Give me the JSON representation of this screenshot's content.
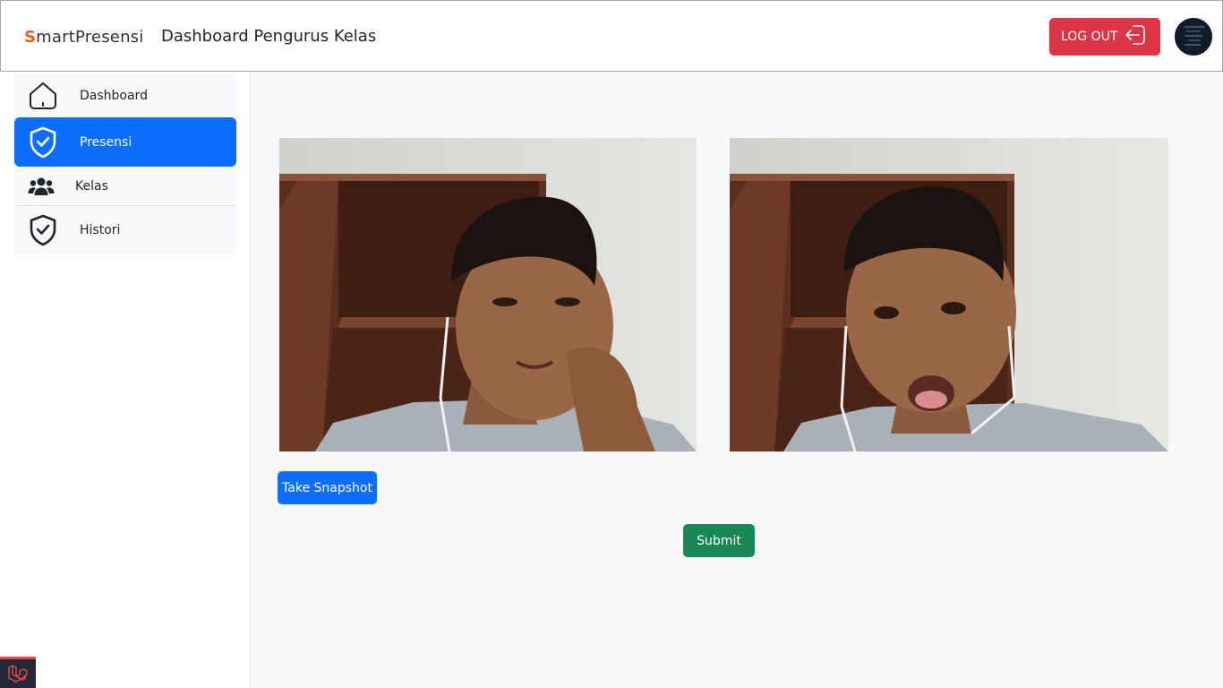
{
  "header": {
    "brand_first": "S",
    "brand_rest": "martPresensi",
    "title": "Dashboard Pengurus Kelas",
    "logout_label": "LOG OUT",
    "logout_icon": "logout-icon",
    "avatar_icon": "user-avatar"
  },
  "sidebar": {
    "items": [
      {
        "label": "Dashboard",
        "icon": "home-icon",
        "active": false
      },
      {
        "label": "Presensi",
        "icon": "shield-check-icon",
        "active": true
      },
      {
        "label": "Kelas",
        "icon": "users-icon",
        "active": false
      },
      {
        "label": "Histori",
        "icon": "shield-check-icon",
        "active": false
      }
    ]
  },
  "main": {
    "camera_feeds": [
      "live-camera-feed",
      "snapshot-preview"
    ],
    "snapshot_label": "Take Snapshot",
    "submit_label": "Submit"
  },
  "colors": {
    "primary": "#0d6efd",
    "danger": "#dc3545",
    "success": "#198754",
    "brand_accent": "#e8601c"
  }
}
